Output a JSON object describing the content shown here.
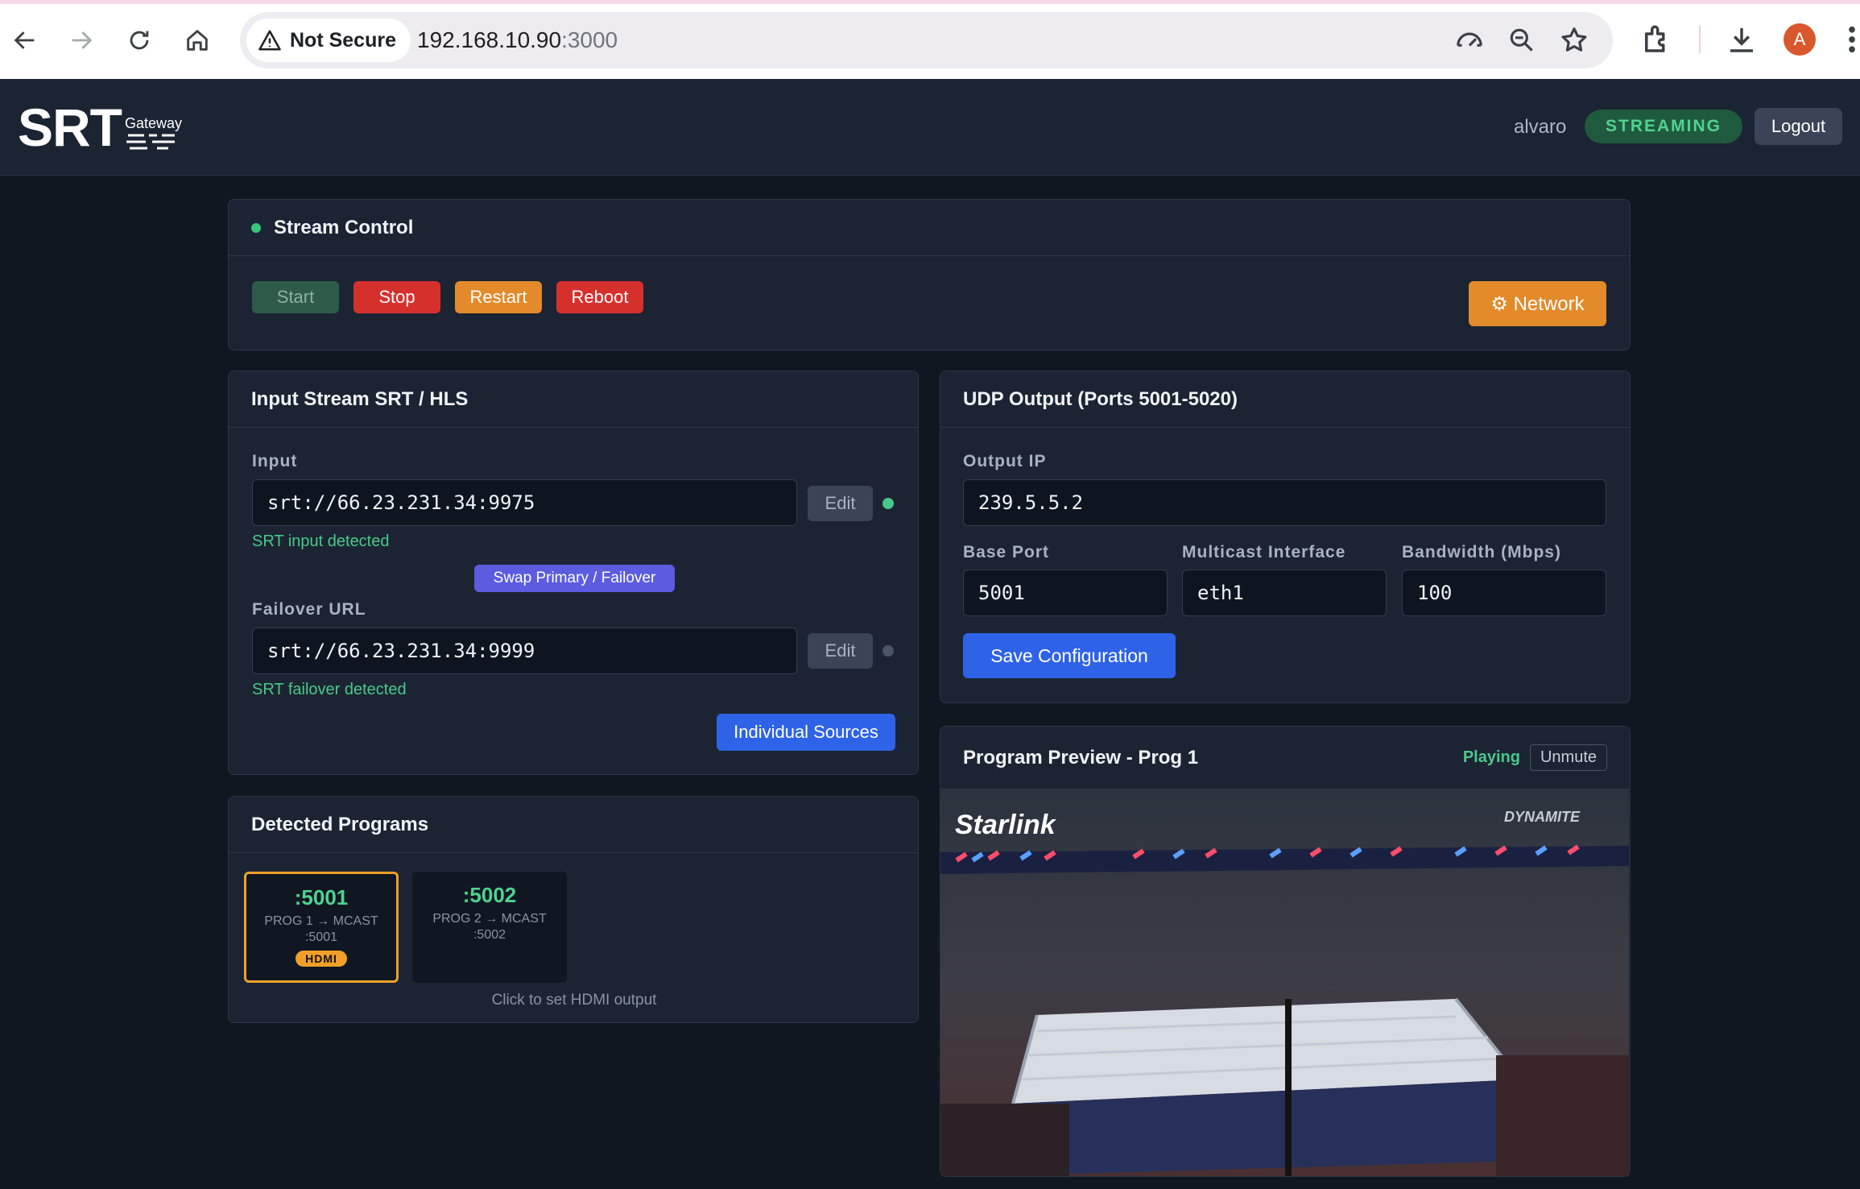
{
  "browser": {
    "security_label": "Not Secure",
    "url_host": "192.168.10.90",
    "url_port": ":3000",
    "profile_initial": "A"
  },
  "header": {
    "logo_text": "SRT",
    "logo_sub": "Gateway",
    "username": "alvaro",
    "status": "STREAMING",
    "logout_label": "Logout"
  },
  "stream_control": {
    "title": "Stream Control",
    "start_label": "Start",
    "stop_label": "Stop",
    "restart_label": "Restart",
    "reboot_label": "Reboot",
    "network_label": "⚙ Network"
  },
  "input_stream": {
    "title": "Input Stream SRT / HLS",
    "input_label": "Input",
    "input_value": "srt://66.23.231.34:9975",
    "edit_label": "Edit",
    "input_status": "SRT input detected",
    "swap_label": "Swap Primary / Failover",
    "failover_label": "Failover URL",
    "failover_value": "srt://66.23.231.34:9999",
    "failover_status": "SRT failover detected",
    "individual_label": "Individual Sources"
  },
  "udp_output": {
    "title": "UDP Output (Ports 5001-5020)",
    "output_ip_label": "Output IP",
    "output_ip_value": "239.5.5.2",
    "base_port_label": "Base Port",
    "base_port_value": "5001",
    "mcast_label": "Multicast Interface",
    "mcast_value": "eth1",
    "bandwidth_label": "Bandwidth (Mbps)",
    "bandwidth_value": "100",
    "save_label": "Save Configuration"
  },
  "programs": {
    "title": "Detected Programs",
    "items": [
      {
        "port": ":5001",
        "desc_line1": "PROG 1 → MCAST",
        "desc_line2": ":5001",
        "badge": "HDMI"
      },
      {
        "port": ":5002",
        "desc_line1": "PROG 2 → MCAST",
        "desc_line2": ":5002"
      }
    ],
    "hint": "Click to set HDMI output"
  },
  "preview": {
    "title": "Program Preview - Prog 1",
    "state": "Playing",
    "unmute_label": "Unmute",
    "sponsor_text": "Starlink",
    "show_text": "DYNAMITE"
  },
  "colors": {
    "accent_green": "#4fd38e",
    "stop_red": "#d6302d",
    "restart_orange": "#e38a2a",
    "network_orange": "#e38a2a",
    "primary_blue": "#2e63e8",
    "swap_purple": "#5b5ce0"
  }
}
